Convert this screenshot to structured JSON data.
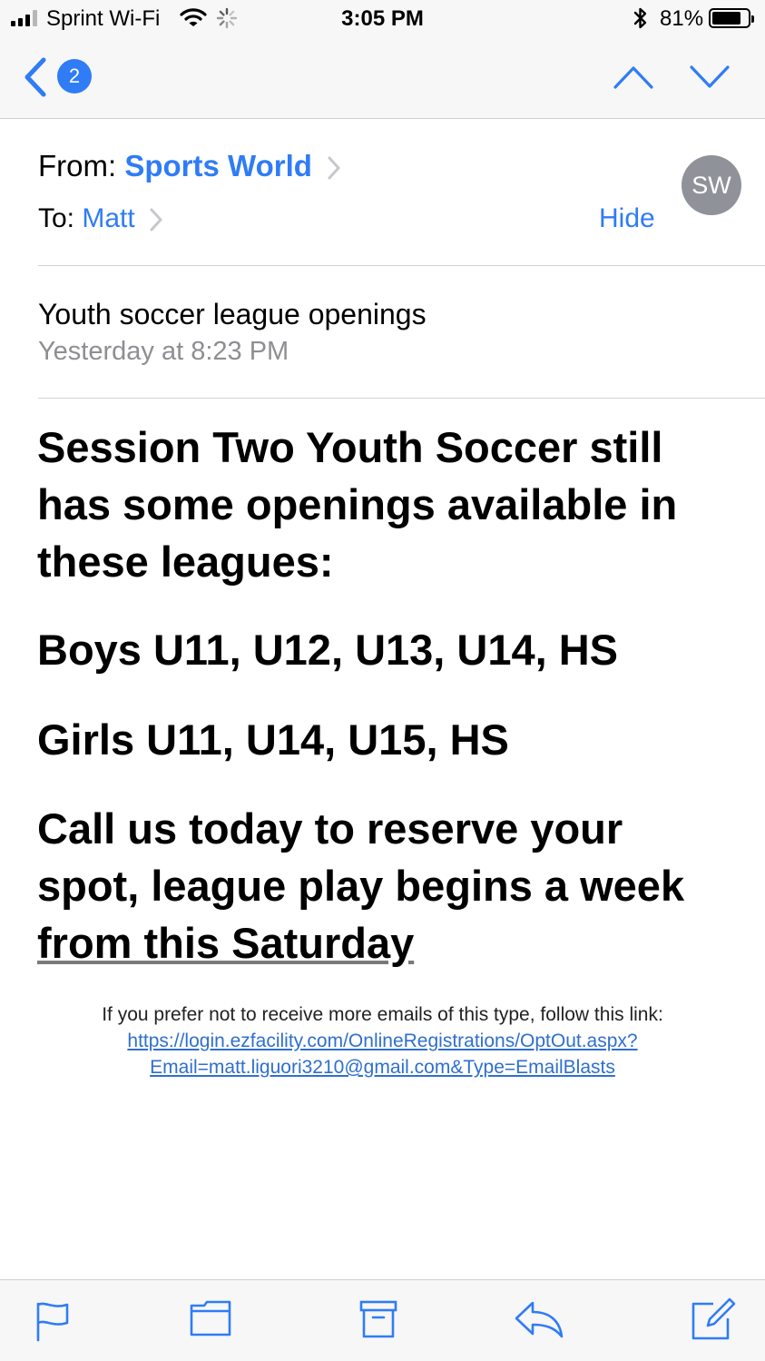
{
  "status_bar": {
    "carrier": "Sprint Wi-Fi",
    "time": "3:05 PM",
    "battery_percent": "81%",
    "battery_level": 0.81
  },
  "nav": {
    "unread_count": "2"
  },
  "header": {
    "from_label": "From:",
    "from_name": "Sports World",
    "to_label": "To:",
    "to_name": "Matt",
    "hide_label": "Hide",
    "avatar_initials": "SW"
  },
  "message": {
    "subject": "Youth soccer league openings",
    "date": "Yesterday at 8:23 PM",
    "paragraph1": "Session Two Youth Soccer still has some openings available in these leagues:",
    "paragraph2": "Boys U11, U12, U13, U14, HS",
    "paragraph3": "Girls U11, U14, U15, HS",
    "paragraph4_start": "Call us today to reserve your spot, league play begins a week ",
    "paragraph4_underlined": "from this Saturday",
    "optout_text": "If you prefer not to receive more emails of this type, follow this link:",
    "optout_link_line1": "https://login.ezfacility.com/OnlineRegistrations/OptOut.aspx?",
    "optout_link_line2": "Email=matt.liguori3210@gmail.com&Type=EmailBlasts"
  },
  "toolbar": {
    "icons": [
      "flag-icon",
      "folder-icon",
      "archive-icon",
      "reply-icon",
      "compose-icon"
    ]
  },
  "colors": {
    "accent": "#2f7cf6",
    "avatar_bg": "#8f9299",
    "muted_text": "#8e8e93",
    "link": "#2f6fcf"
  }
}
